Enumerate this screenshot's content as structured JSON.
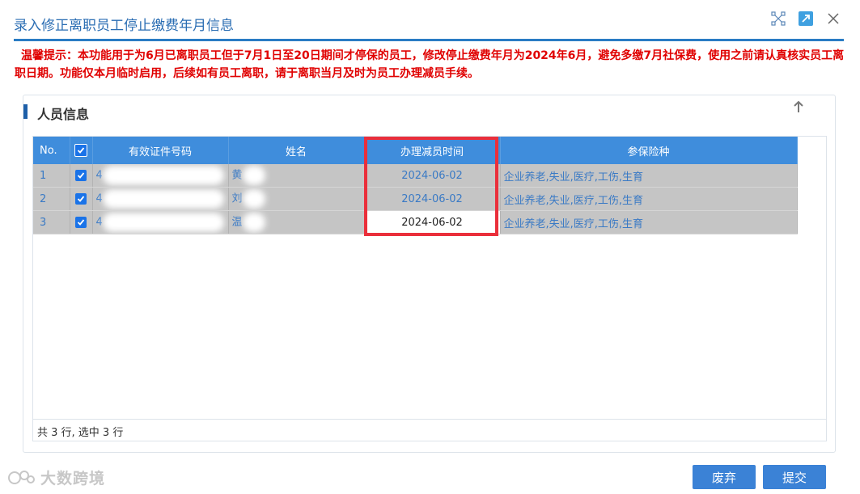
{
  "window": {
    "title": "录入修正离职员工停止缴费年月信息",
    "icons": [
      "expand-icon",
      "popout-icon",
      "close-icon"
    ]
  },
  "warning": "温馨提示：本功能用于为6月已离职员工但于7月1日至20日期间才停保的员工，修改停止缴费年月为2024年6月，避免多缴7月社保费，使用之前请认真核实员工离职日期。功能仅本月临时启用，后续如有员工离职，请于离职当月及时为员工办理减员手续。",
  "panel": {
    "title": "人员信息",
    "collapse_icon": "arrow-up-icon"
  },
  "table": {
    "columns": [
      "No.",
      "",
      "有效证件号码",
      "姓名",
      "办理减员时间",
      "参保险种"
    ],
    "header_checked": true,
    "rows": [
      {
        "no": "1",
        "checked": true,
        "id_prefix": "4",
        "name_prefix": "黄",
        "date": "2024-06-02",
        "insurance": "企业养老,失业,医疗,工伤,生育"
      },
      {
        "no": "2",
        "checked": true,
        "id_prefix": "4",
        "name_prefix": "刘",
        "date": "2024-06-02",
        "insurance": "企业养老,失业,医疗,工伤,生育"
      },
      {
        "no": "3",
        "checked": true,
        "id_prefix": "4",
        "name_prefix": "温",
        "date": "2024-06-02",
        "insurance": "企业养老,失业,医疗,工伤,生育"
      }
    ],
    "footer": "共 3 行, 选中 3 行"
  },
  "watermark": "大数跨境",
  "buttons": {
    "discard": "废弃",
    "submit": "提交"
  },
  "colors": {
    "title": "#2a6db3",
    "header_bg": "#3f8ddc",
    "row_bg": "#c5c5c5",
    "warning": "#e00000",
    "highlight": "#ea2f3b",
    "button": "#3b82d6"
  }
}
